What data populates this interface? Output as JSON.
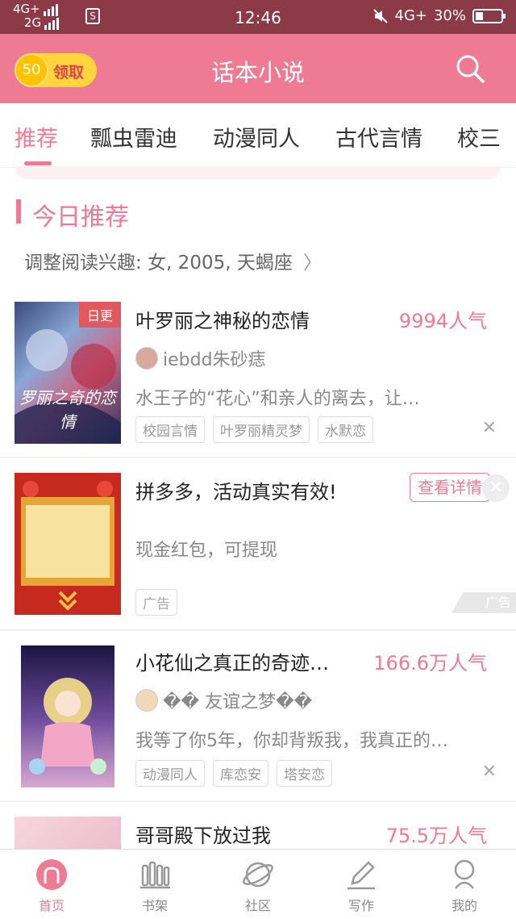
{
  "status_bar": {
    "network_top": "4G+",
    "network_bottom": "2G",
    "sim_icon": "S",
    "time": "12:46",
    "network_right": "4G+",
    "battery": "30%"
  },
  "header": {
    "coin_value": "50",
    "coin_label": "领取",
    "title": "话本小说"
  },
  "tabs": [
    {
      "label": "推荐"
    },
    {
      "label": "瓢虫雷迪"
    },
    {
      "label": "动漫同人"
    },
    {
      "label": "古代言情"
    },
    {
      "label": "校三"
    }
  ],
  "section": {
    "title": "今日推荐",
    "interest": "调整阅读兴趣: 女, 2005, 天蝎座"
  },
  "books": [
    {
      "title": "叶罗丽之神秘的恋情",
      "popularity": "9994人气",
      "author": "iebdd朱砂痣",
      "desc": "水王子的“花心”和亲人的离去，让…",
      "tags": [
        "校园言情",
        "叶罗丽精灵梦",
        "水默恋"
      ],
      "badge": "日更",
      "cover_text": "罗丽之奇的恋情"
    },
    {
      "title": "小花仙之真正的奇迹…",
      "popularity": "166.6万人气",
      "author": "�� 友谊之梦��",
      "desc": "我等了你5年，你却背叛我，我真正的…",
      "tags": [
        "动漫同人",
        "库恋安",
        "塔安恋"
      ]
    },
    {
      "title": "哥哥殿下放过我",
      "popularity": "75.5万人气"
    }
  ],
  "ad": {
    "title": "拼多多，活动真实有效!",
    "button": "查看详情",
    "desc": "现金红包，可提现",
    "tag": "广告",
    "mark": "广告"
  },
  "bottom_nav": [
    {
      "label": "首页",
      "icon": "home-icon"
    },
    {
      "label": "书架",
      "icon": "bookshelf-icon"
    },
    {
      "label": "社区",
      "icon": "planet-icon"
    },
    {
      "label": "写作",
      "icon": "pen-icon"
    },
    {
      "label": "我的",
      "icon": "profile-icon"
    }
  ],
  "colors": {
    "accent": "#ef7a93",
    "status_bar": "#8c3a48",
    "coin": "#ffd53d"
  }
}
